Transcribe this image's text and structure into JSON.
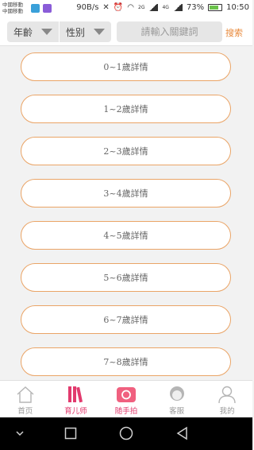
{
  "status_bar": {
    "carrier_1": "中國移動",
    "carrier_2": "中國移動",
    "network_speed": "90B/s",
    "signal_label": "2G",
    "signal_label_2": "4G",
    "battery_percent": "73%",
    "time": "10:50"
  },
  "filters": {
    "age_label": "年齡",
    "gender_label": "性别",
    "search_placeholder": "請輸入關鍵詞",
    "search_button": "搜索"
  },
  "list": {
    "items": [
      "0~1歲詳情",
      "1~2歲詳情",
      "2~3歲詳情",
      "3~4歲詳情",
      "4~5歲詳情",
      "5~6歲詳情",
      "6~7歲詳情",
      "7~8歲詳情"
    ]
  },
  "tabs": [
    {
      "label": "首页",
      "icon": "home-icon"
    },
    {
      "label": "育儿师",
      "icon": "books-icon"
    },
    {
      "label": "随手拍",
      "icon": "camera-icon"
    },
    {
      "label": "客服",
      "icon": "service-icon"
    },
    {
      "label": "我的",
      "icon": "person-icon"
    }
  ],
  "colors": {
    "accent": "#e8893b",
    "pill_border": "#eaa466",
    "active_tab": "#e23a6d"
  }
}
